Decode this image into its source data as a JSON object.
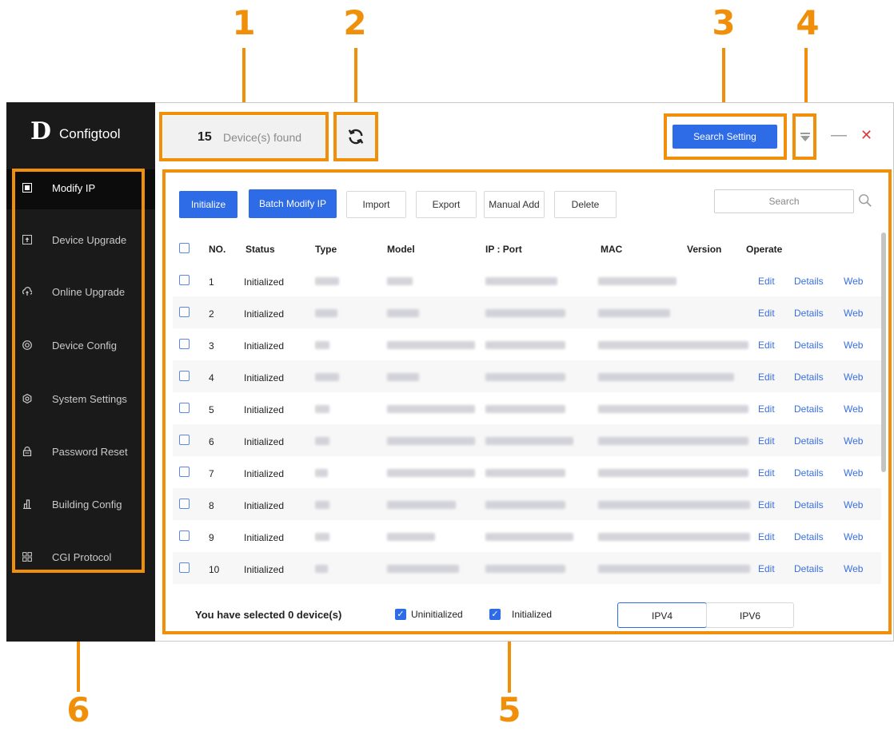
{
  "callouts": [
    "1",
    "2",
    "3",
    "4",
    "5",
    "6"
  ],
  "app": {
    "logo_mark": "D",
    "name": "Configtool"
  },
  "sidebar": {
    "items": [
      {
        "label": "Modify IP",
        "icon": "ip-icon",
        "active": true
      },
      {
        "label": "Device Upgrade",
        "icon": "upgrade-icon",
        "active": false
      },
      {
        "label": "Online Upgrade",
        "icon": "cloud-upload-icon",
        "active": false
      },
      {
        "label": "Device Config",
        "icon": "target-icon",
        "active": false
      },
      {
        "label": "System Settings",
        "icon": "gear-icon",
        "active": false
      },
      {
        "label": "Password Reset",
        "icon": "lock-icon",
        "active": false
      },
      {
        "label": "Building Config",
        "icon": "building-icon",
        "active": false
      },
      {
        "label": "CGI Protocol",
        "icon": "grid-icon",
        "active": false
      }
    ]
  },
  "header": {
    "device_count": "15",
    "device_count_label": "Device(s) found",
    "search_setting_label": "Search Setting",
    "minimize_glyph": "—",
    "close_glyph": "✕"
  },
  "toolbar": {
    "initialize": "Initialize",
    "batch_modify_ip": "Batch Modify IP",
    "import": "Import",
    "export": "Export",
    "manual_add": "Manual Add",
    "delete": "Delete",
    "search_placeholder": "Search"
  },
  "table": {
    "columns": [
      "NO.",
      "Status",
      "Type",
      "Model",
      "IP : Port",
      "MAC",
      "Version",
      "Operate"
    ],
    "rows": [
      {
        "no": "1",
        "status": "Initialized"
      },
      {
        "no": "2",
        "status": "Initialized"
      },
      {
        "no": "3",
        "status": "Initialized"
      },
      {
        "no": "4",
        "status": "Initialized"
      },
      {
        "no": "5",
        "status": "Initialized"
      },
      {
        "no": "6",
        "status": "Initialized"
      },
      {
        "no": "7",
        "status": "Initialized"
      },
      {
        "no": "8",
        "status": "Initialized"
      },
      {
        "no": "9",
        "status": "Initialized"
      },
      {
        "no": "10",
        "status": "Initialized"
      }
    ],
    "actions": [
      "Edit",
      "Details",
      "Web"
    ]
  },
  "footer": {
    "selected_text": "You have selected 0  device(s)",
    "filter_uninitialized": "Uninitialized",
    "filter_initialized": "Initialized",
    "ipv4": "IPV4",
    "ipv6": "IPV6"
  },
  "colors": {
    "accent": "#2e6be6",
    "callout": "#f0900a",
    "sidebar": "#1a1a1a"
  }
}
